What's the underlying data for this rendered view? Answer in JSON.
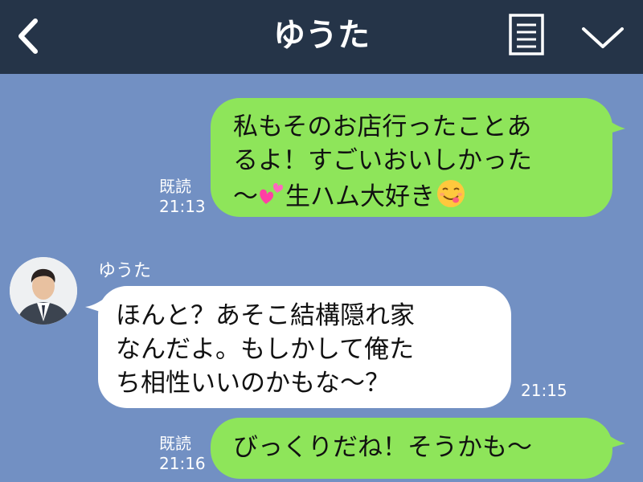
{
  "header": {
    "title": "ゆうた",
    "back_icon": "chevron-left-icon",
    "menu_icon": "notes-icon",
    "dropdown_icon": "chevron-down-icon",
    "background": "#253448"
  },
  "chat": {
    "background": "#7290c3",
    "messages": [
      {
        "side": "right",
        "lines": [
          "私もそのお店行ったことあ",
          "るよ！すごいおいしかった",
          "〜",
          "生ハム大好き"
        ],
        "emojis": [
          "two-hearts-icon",
          "yum-face-icon"
        ],
        "read_label": "既読",
        "time": "21:13"
      },
      {
        "side": "left",
        "sender": "ゆうた",
        "lines": [
          "ほんと？あそこ結構隠れ家",
          "なんだよ。もしかして俺た",
          "ち相性いいのかもな〜？"
        ],
        "time": "21:15"
      },
      {
        "side": "right",
        "lines": [
          "びっくりだね！そうかも〜"
        ],
        "read_label": "既読",
        "time": "21:16"
      }
    ],
    "bubble_colors": {
      "sent": "#8ee55a",
      "received": "#ffffff"
    }
  }
}
